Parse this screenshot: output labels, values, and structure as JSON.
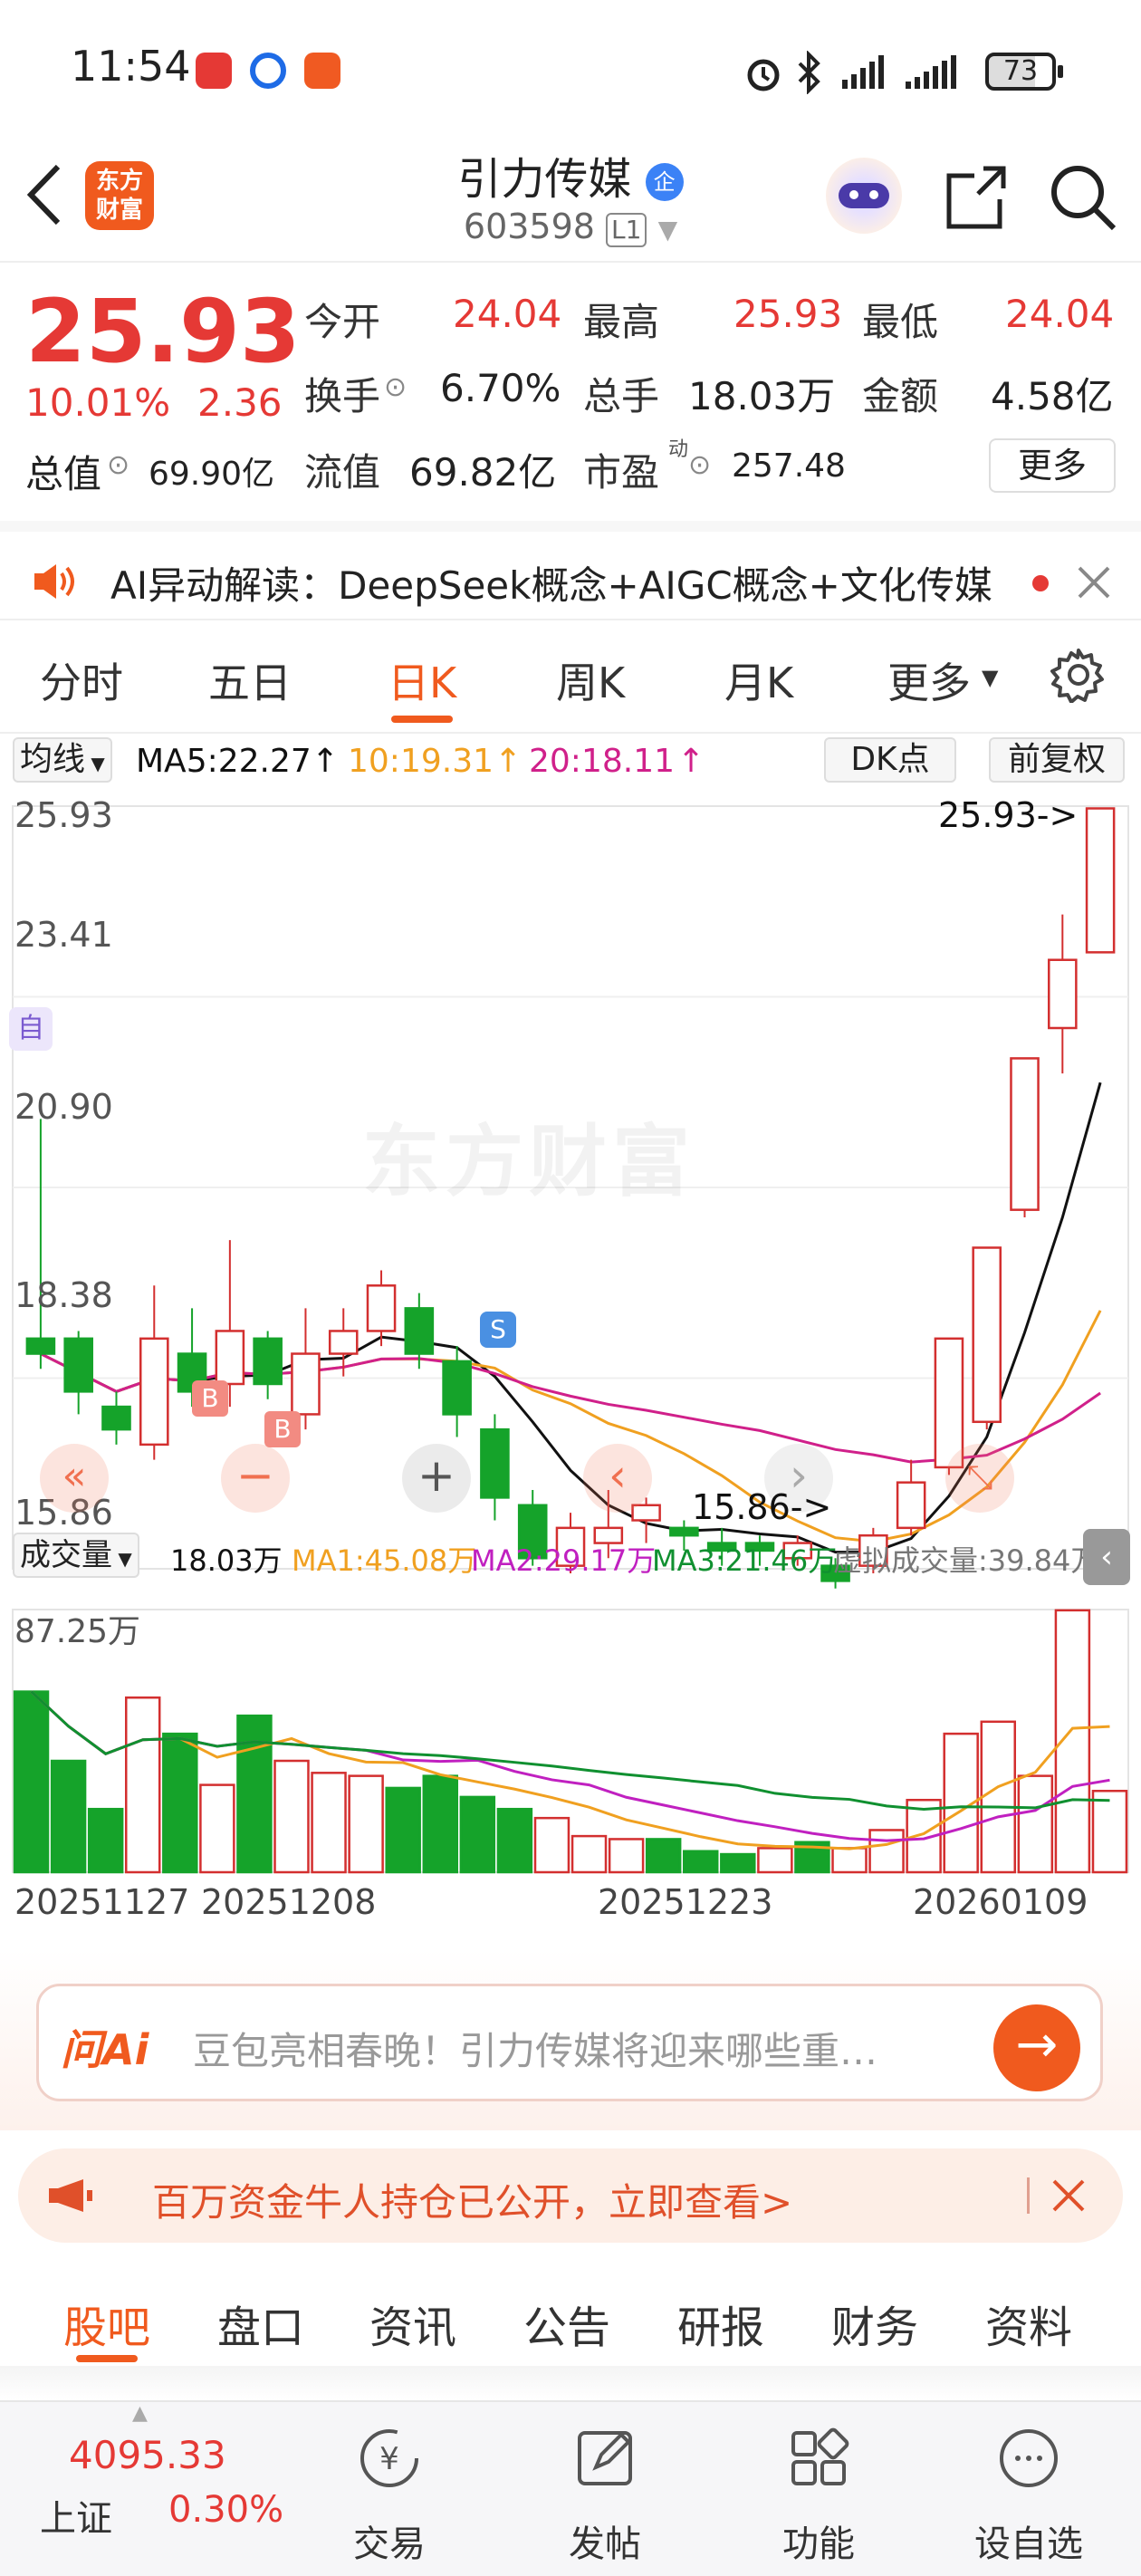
{
  "status_bar": {
    "time": "11:54",
    "battery": "73",
    "app_icons": [
      {
        "name": "huawei-store-icon",
        "color": "#e53935"
      },
      {
        "name": "baidu-netdisk-icon",
        "color": "#1e6be6"
      },
      {
        "name": "message-icon",
        "color": "#f05a22"
      }
    ]
  },
  "header": {
    "brand_logo_text": "东方\n财富",
    "stock_name": "引力传媒",
    "enterprise_badge": "企",
    "stock_code": "603598",
    "level_badge": "L1"
  },
  "quote": {
    "price": "25.93",
    "change_pct": "10.01%",
    "change": "2.36",
    "open_label": "今开",
    "open": "24.04",
    "high_label": "最高",
    "high": "25.93",
    "low_label": "最低",
    "low": "24.04",
    "turnover_label": "换手",
    "turnover": "6.70%",
    "volume_label": "总手",
    "volume": "18.03万",
    "amount_label": "金额",
    "amount": "4.58亿",
    "mktcap_label": "总值",
    "mktcap": "69.90亿",
    "float_label": "流值",
    "float": "69.82亿",
    "pe_label": "市盈",
    "pe_sup": "动",
    "pe": "257.48",
    "more_button": "更多"
  },
  "ticker": {
    "text": "AI异动解读：DeepSeek概念+AIGC概念+文化传媒"
  },
  "chart_tabs": [
    "分时",
    "五日",
    "日K",
    "周K",
    "月K",
    "更多"
  ],
  "active_tab": 2,
  "kline": {
    "ma_selector": "均线",
    "ma5": "MA5:22.27",
    "ma10": "10:19.31",
    "ma20": "20:18.11",
    "dk_button": "DK点",
    "adjust_button": "前复权",
    "y_labels": [
      "25.93",
      "23.41",
      "20.90",
      "18.38",
      "15.86"
    ],
    "max_annotation": "25.93->",
    "min_annotation": "15.86->",
    "self_badge": "自",
    "buy_marker": "B",
    "sell_marker": "S",
    "watermark": "东方财富",
    "colors": {
      "up": "#d32f2f",
      "down": "#15a32a",
      "ma5": "#111111",
      "ma10": "#f0a020",
      "ma20": "#d0208a"
    }
  },
  "volume": {
    "selector": "成交量",
    "current": "18.03万",
    "ma1": "MA1:45.08万",
    "ma2": "MA2:29.17万",
    "ma3": "MA3:21.46万",
    "virtual": "虚拟成交量:39.84万",
    "max_label": "87.25万",
    "dates": [
      "20251127",
      "20251208",
      "20251223",
      "20260109"
    ]
  },
  "chart_data": {
    "type": "candlestick",
    "title": "",
    "candles": [
      {
        "o": 18.9,
        "c": 18.7,
        "h": 21.8,
        "l": 18.5
      },
      {
        "o": 18.9,
        "c": 18.2,
        "h": 19.0,
        "l": 17.9
      },
      {
        "o": 18.0,
        "c": 17.7,
        "h": 18.2,
        "l": 17.5
      },
      {
        "o": 17.5,
        "c": 18.9,
        "h": 19.6,
        "l": 17.3
      },
      {
        "o": 18.7,
        "c": 18.2,
        "h": 19.3,
        "l": 18.0
      },
      {
        "o": 18.3,
        "c": 19.0,
        "h": 20.2,
        "l": 18.0
      },
      {
        "o": 18.9,
        "c": 18.3,
        "h": 19.0,
        "l": 18.1
      },
      {
        "o": 17.9,
        "c": 18.7,
        "h": 19.3,
        "l": 17.7
      },
      {
        "o": 18.7,
        "c": 19.0,
        "h": 19.3,
        "l": 18.4
      },
      {
        "o": 19.0,
        "c": 19.6,
        "h": 19.8,
        "l": 18.8
      },
      {
        "o": 19.3,
        "c": 18.7,
        "h": 19.5,
        "l": 18.5
      },
      {
        "o": 18.6,
        "c": 17.9,
        "h": 18.8,
        "l": 17.6
      },
      {
        "o": 17.7,
        "c": 16.8,
        "h": 17.9,
        "l": 16.5
      },
      {
        "o": 16.7,
        "c": 16.0,
        "h": 16.9,
        "l": 15.9
      },
      {
        "o": 15.9,
        "c": 16.4,
        "h": 16.6,
        "l": 15.8
      },
      {
        "o": 16.2,
        "c": 16.4,
        "h": 16.9,
        "l": 16.0
      },
      {
        "o": 16.5,
        "c": 16.7,
        "h": 16.8,
        "l": 16.2
      },
      {
        "o": 16.4,
        "c": 16.3,
        "h": 16.5,
        "l": 16.1
      },
      {
        "o": 16.2,
        "c": 16.1,
        "h": 16.4,
        "l": 15.9
      },
      {
        "o": 16.2,
        "c": 16.1,
        "h": 16.3,
        "l": 15.9
      },
      {
        "o": 16.0,
        "c": 16.2,
        "h": 16.3,
        "l": 15.9
      },
      {
        "o": 15.9,
        "c": 15.7,
        "h": 16.0,
        "l": 15.6
      },
      {
        "o": 15.9,
        "c": 16.3,
        "h": 16.4,
        "l": 15.8
      },
      {
        "o": 16.4,
        "c": 17.0,
        "h": 17.3,
        "l": 16.3
      },
      {
        "o": 17.2,
        "c": 18.9,
        "h": 18.9,
        "l": 17.1
      },
      {
        "o": 17.8,
        "c": 20.1,
        "h": 20.1,
        "l": 17.7
      },
      {
        "o": 20.6,
        "c": 22.6,
        "h": 22.6,
        "l": 20.5
      },
      {
        "o": 23.0,
        "c": 23.9,
        "h": 24.5,
        "l": 22.4
      },
      {
        "o": 24.0,
        "c": 25.9,
        "h": 25.9,
        "l": 24.0
      }
    ],
    "volumes": [
      60,
      37,
      21,
      58,
      46,
      29,
      52,
      37,
      33,
      32,
      28,
      32,
      25,
      21,
      18,
      12,
      11,
      11,
      7,
      6,
      8,
      10,
      8,
      14,
      24,
      46,
      50,
      32,
      87,
      27
    ],
    "ylim": [
      15.86,
      25.93
    ],
    "volume_max": 87.25
  },
  "ai_input": {
    "logo": "问Ai",
    "placeholder": "豆包亮相春晚！引力传媒将迎来哪些重…"
  },
  "promo": {
    "text": "百万资金牛人持仓已公开，立即查看>"
  },
  "sub_tabs": [
    "股吧",
    "盘口",
    "资讯",
    "公告",
    "研报",
    "财务",
    "资料"
  ],
  "active_sub_tab": 0,
  "bottom_bar": {
    "index_value": "4095.33",
    "index_name": "上证",
    "index_change": "0.30%",
    "items": [
      "交易",
      "发帖",
      "功能",
      "设自选"
    ]
  }
}
